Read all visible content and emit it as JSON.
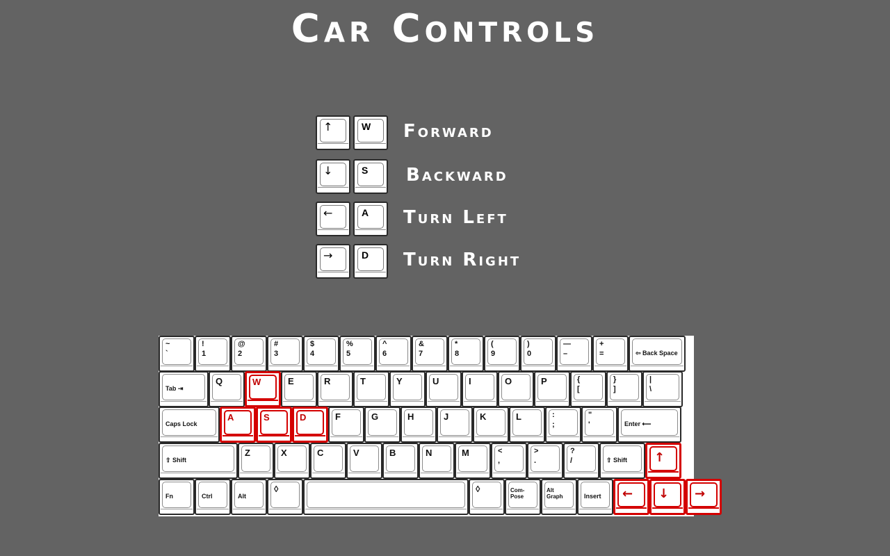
{
  "title": "Car Controls",
  "colors": {
    "background": "#636363",
    "text": "#ffffff",
    "highlight": "#d40000"
  },
  "legend": [
    {
      "arrow_icon": "arrow-up-icon",
      "arrow": "↑",
      "key": "W",
      "action": "Forward"
    },
    {
      "arrow_icon": "arrow-down-icon",
      "arrow": "↓",
      "key": "S",
      "action": "Backward"
    },
    {
      "arrow_icon": "arrow-left-icon",
      "arrow": "←",
      "key": "A",
      "action": "Turn Left"
    },
    {
      "arrow_icon": "arrow-right-icon",
      "arrow": "→",
      "key": "D",
      "action": "Turn Right"
    }
  ],
  "keyboard": {
    "rows": [
      [
        {
          "label": "~\n`"
        },
        {
          "label": "!\n1"
        },
        {
          "label": "@\n2"
        },
        {
          "label": "#\n3"
        },
        {
          "label": "$\n4"
        },
        {
          "label": "%\n5"
        },
        {
          "label": "^\n6"
        },
        {
          "label": "&\n7"
        },
        {
          "label": "*\n8"
        },
        {
          "label": "(\n9"
        },
        {
          "label": ")\n0"
        },
        {
          "label": "—\n–"
        },
        {
          "label": "+\n="
        },
        {
          "label": "⇦ Back Space",
          "small": true
        }
      ],
      [
        {
          "label": "Tab ⇥",
          "small": true
        },
        {
          "label": "Q"
        },
        {
          "label": "W",
          "highlight": true
        },
        {
          "label": "E"
        },
        {
          "label": "R"
        },
        {
          "label": "T"
        },
        {
          "label": "Y"
        },
        {
          "label": "U"
        },
        {
          "label": "I"
        },
        {
          "label": "O"
        },
        {
          "label": "P"
        },
        {
          "label": "{\n["
        },
        {
          "label": "}\n]"
        },
        {
          "label": "|\n\\"
        }
      ],
      [
        {
          "label": "Caps Lock",
          "small": true
        },
        {
          "label": "A",
          "highlight": true
        },
        {
          "label": "S",
          "highlight": true
        },
        {
          "label": "D",
          "highlight": true
        },
        {
          "label": "F"
        },
        {
          "label": "G"
        },
        {
          "label": "H"
        },
        {
          "label": "J"
        },
        {
          "label": "K"
        },
        {
          "label": "L"
        },
        {
          "label": ":\n;"
        },
        {
          "label": "\"\n'"
        },
        {
          "label": "Enter ⟵",
          "small": true
        }
      ],
      [
        {
          "label": "⇧ Shift",
          "small": true
        },
        {
          "label": "Z"
        },
        {
          "label": "X"
        },
        {
          "label": "C"
        },
        {
          "label": "V"
        },
        {
          "label": "B"
        },
        {
          "label": "N"
        },
        {
          "label": "M"
        },
        {
          "label": "<\n,"
        },
        {
          "label": ">\n."
        },
        {
          "label": "?\n/"
        },
        {
          "label": "⇧ Shift",
          "small": true
        },
        {
          "label": "↑",
          "highlight": true,
          "arrow": true
        }
      ],
      [
        {
          "label": "Fn",
          "small": true
        },
        {
          "label": "Ctrl",
          "small": true
        },
        {
          "label": "Alt",
          "small": true
        },
        {
          "label": "◊"
        },
        {
          "label": ""
        },
        {
          "label": "◊"
        },
        {
          "label": "Com-\nPose",
          "tiny": true
        },
        {
          "label": "Alt\nGraph",
          "tiny": true
        },
        {
          "label": "Insert",
          "small": true
        },
        {
          "label": "←",
          "highlight": true,
          "arrow": true
        },
        {
          "label": "↓",
          "highlight": true,
          "arrow": true
        },
        {
          "label": "→",
          "highlight": true,
          "arrow": true
        }
      ]
    ]
  }
}
